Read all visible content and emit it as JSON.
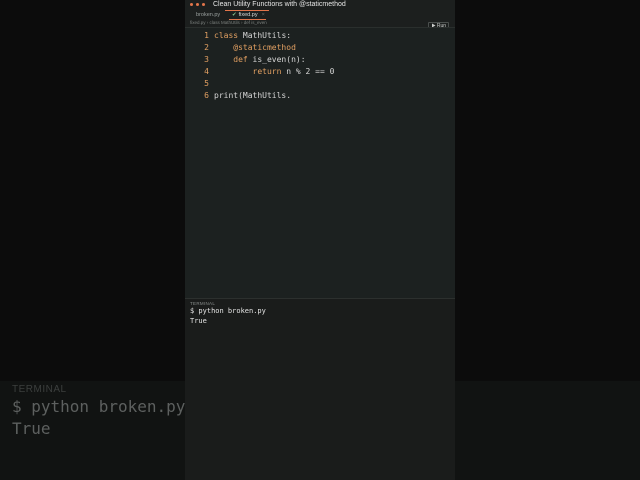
{
  "window": {
    "title": "Clean Utility Functions with @staticmethod"
  },
  "tabs": [
    {
      "label": "broken.py",
      "active": false
    },
    {
      "label": "fixed.py",
      "active": true,
      "close": "×"
    }
  ],
  "toolbar": {
    "run_label": "Run",
    "run_icon": "play-icon"
  },
  "breadcrumb": "fixed.py › class MathUtils › def is_even",
  "editor": {
    "lines": [
      {
        "n": "1",
        "text": "class MathUtils:"
      },
      {
        "n": "2",
        "text": "    @staticmethod"
      },
      {
        "n": "3",
        "text": "    def is_even(n):"
      },
      {
        "n": "4",
        "text": "        return n % 2 == 0"
      },
      {
        "n": "5",
        "text": ""
      },
      {
        "n": "6",
        "text": "print(MathUtils."
      }
    ]
  },
  "terminal": {
    "label": "TERMINAL",
    "command": "$ python broken.py",
    "output": "True"
  },
  "background": {
    "label": "TERMINAL",
    "command": "$ python broken.py",
    "output": "True"
  },
  "colors": {
    "accent": "#e2754a",
    "keyword": "#e2a062",
    "panel": "#1c1f1e"
  }
}
